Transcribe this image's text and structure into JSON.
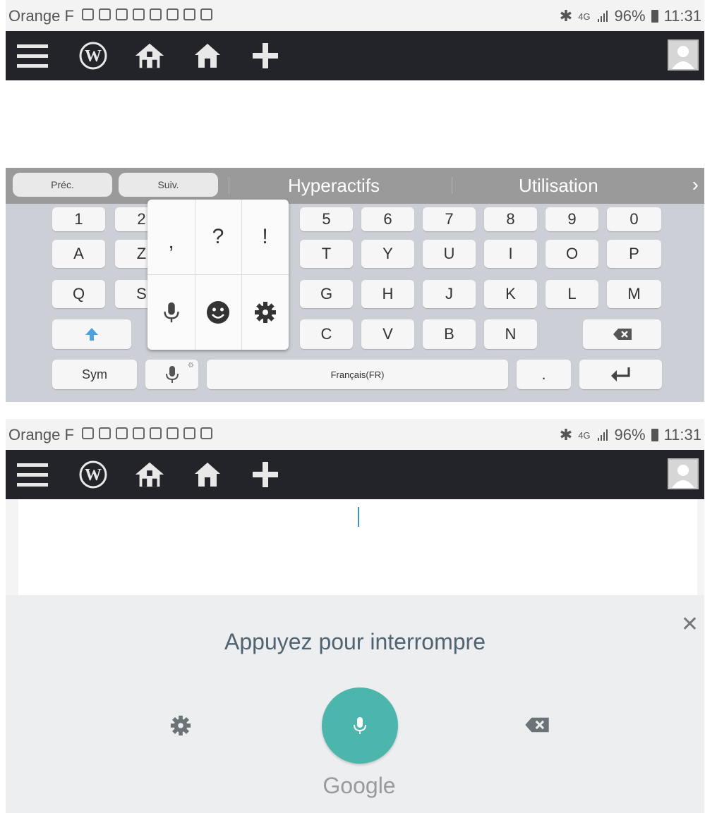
{
  "screens": [
    {
      "status": {
        "carrier": "Orange F",
        "network": "4G",
        "battery": "96%",
        "time": "11:31"
      },
      "toolbar": {
        "icons": [
          "menu-icon",
          "wordpress-icon",
          "my-sites-icon",
          "home-icon",
          "add-icon"
        ]
      },
      "suggestions": {
        "prev": "Préc.",
        "next": "Suiv.",
        "words": [
          "Hyperactifs",
          "Utilisation"
        ]
      },
      "keyboard": {
        "row1": [
          "1",
          "2",
          "5",
          "6",
          "7",
          "8",
          "9",
          "0"
        ],
        "row2": [
          "A",
          "Z",
          "T",
          "Y",
          "U",
          "I",
          "O",
          "P"
        ],
        "row3": [
          "Q",
          "S",
          "G",
          "H",
          "J",
          "K",
          "L",
          "M"
        ],
        "row4": [
          "C",
          "V",
          "B",
          "N"
        ],
        "sym": "Sym",
        "space": "Français(FR)",
        "period": ".",
        "popup": [
          ",",
          "?",
          "!"
        ]
      }
    },
    {
      "status": {
        "carrier": "Orange F",
        "network": "4G",
        "battery": "96%",
        "time": "11:31"
      },
      "voice": {
        "prompt": "Appuyez pour interrompre",
        "brand": "Google"
      }
    }
  ],
  "colors": {
    "toolbar": "#222429",
    "suggestion_bar": "#9a9a9a",
    "keyboard": "#ccd0d6",
    "voice_panel": "#eceef0",
    "mic_button": "#4db6ac",
    "shift_arrow": "#4aa3df"
  }
}
